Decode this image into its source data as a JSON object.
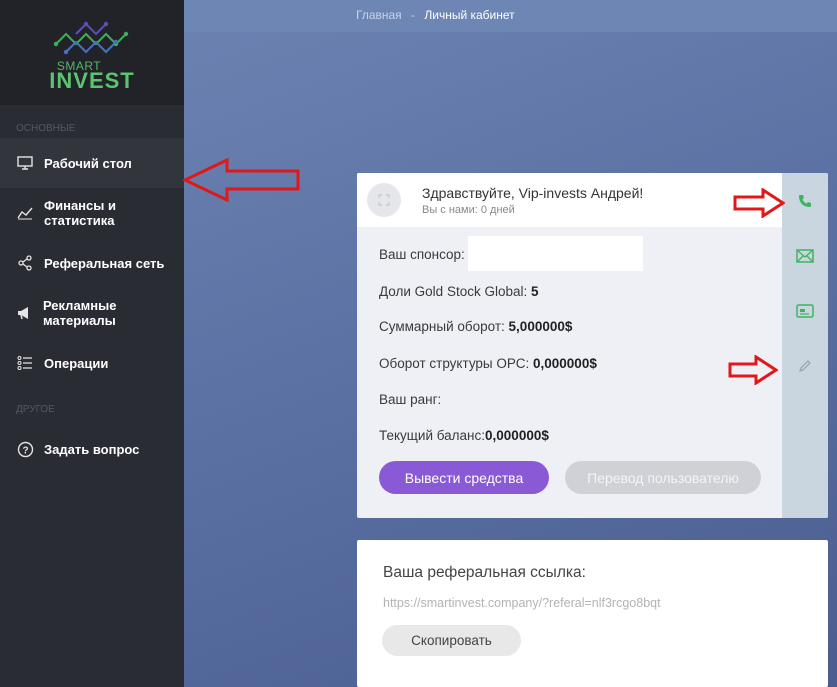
{
  "logo": {
    "line1": "SMART",
    "line2": "INVEST",
    "brand_color": "#5cc36f"
  },
  "sidebar": {
    "section_main": "ОСНОВНЫЕ",
    "section_other": "ДРУГОЕ",
    "items": [
      {
        "label": "Рабочий стол",
        "icon": "monitor-icon"
      },
      {
        "label": "Финансы и статистика",
        "icon": "chart-line-icon"
      },
      {
        "label": "Реферальная сеть",
        "icon": "share-icon"
      },
      {
        "label": "Рекламные материалы",
        "icon": "megaphone-icon"
      },
      {
        "label": "Операции",
        "icon": "list-icon"
      }
    ],
    "other_items": [
      {
        "label": "Задать вопрос",
        "icon": "question-icon"
      }
    ]
  },
  "breadcrumb": {
    "home": "Главная",
    "separator": "-",
    "current": "Личный кабинет"
  },
  "profile": {
    "greeting": "Здравствуйте, Vip-invests Андрей!",
    "days": "Вы с нами: 0 дней",
    "sponsor_label": "Ваш спонсор:",
    "shares_label": "Доли Gold Stock Global:",
    "shares_value": "5",
    "turnover_label": "Суммарный оборот:",
    "turnover_value": "5,000000$",
    "structure_label": "Оборот структуры ОРС:",
    "structure_value": "0,000000$",
    "rank_label": "Ваш ранг:",
    "balance_label": "Текущий баланс:",
    "balance_value": "0,000000$",
    "withdraw_button": "Вывести средства",
    "transfer_button": "Перевод пользователю"
  },
  "side_icons": [
    "phone-icon",
    "mail-icon",
    "card-icon",
    "pencil-icon"
  ],
  "referral": {
    "title": "Ваша реферальная ссылка:",
    "link": "https://smartinvest.company/?referal=nlf3rcgo8bqt",
    "copy_button": "Скопировать"
  },
  "colors": {
    "accent": "#8a5ad6",
    "icon_green": "#3fb45f",
    "arrow_red": "#e01818"
  }
}
